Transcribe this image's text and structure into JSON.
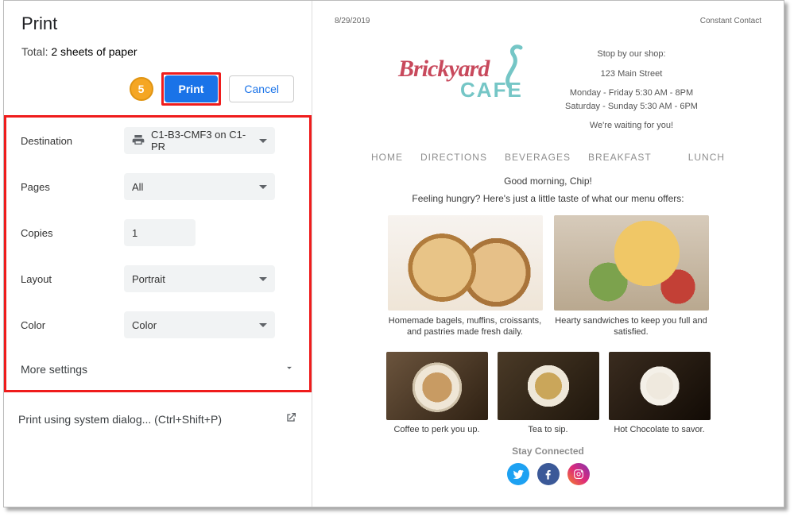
{
  "print": {
    "title": "Print",
    "total_prefix": "Total: ",
    "total_sheets": "2 sheets of paper",
    "step_badge": "5",
    "print_btn": "Print",
    "cancel_btn": "Cancel",
    "settings": {
      "destination_label": "Destination",
      "destination_value": "C1-B3-CMF3 on C1-PR",
      "pages_label": "Pages",
      "pages_value": "All",
      "copies_label": "Copies",
      "copies_value": "1",
      "layout_label": "Layout",
      "layout_value": "Portrait",
      "color_label": "Color",
      "color_value": "Color"
    },
    "more_settings": "More settings",
    "system_dialog": "Print using system dialog... (Ctrl+Shift+P)"
  },
  "preview": {
    "date": "8/29/2019",
    "source": "Constant Contact",
    "logo_line1": "Brickyard",
    "logo_line2": "CAFE",
    "shop": {
      "stop": "Stop by our shop:",
      "address": "123 Main Street",
      "hours1": "Monday - Friday 5:30 AM - 8PM",
      "hours2": "Saturday - Sunday 5:30 AM - 6PM",
      "waiting": "We're waiting for you!"
    },
    "nav": {
      "home": "HOME",
      "directions": "DIRECTIONS",
      "beverages": "BEVERAGES",
      "breakfast": "BREAKFAST",
      "lunch": "LUNCH"
    },
    "greeting": "Good morning, Chip!",
    "tagline": "Feeling hungry? Here's just a little taste of what our menu offers:",
    "cards2": [
      {
        "caption": "Homemade bagels, muffins, croissants, and pastries made fresh daily."
      },
      {
        "caption": "Hearty sandwiches to keep you full and satisfied."
      }
    ],
    "cards3": [
      {
        "caption": "Coffee to perk you up."
      },
      {
        "caption": "Tea to sip."
      },
      {
        "caption": "Hot Chocolate to savor."
      }
    ],
    "stay": "Stay Connected"
  },
  "colors": {
    "twitter": "#1da1f2",
    "facebook": "#3b5998",
    "instagram": "#e1306c"
  }
}
